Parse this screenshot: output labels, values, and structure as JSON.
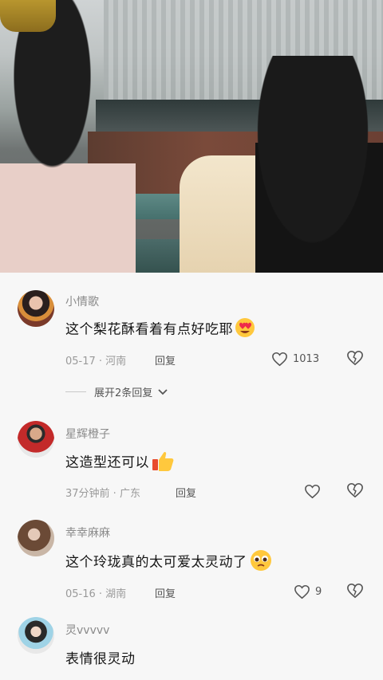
{
  "video": {},
  "comments": [
    {
      "username": "小情歌",
      "text": "这个梨花酥看着有点好吃耶",
      "emoji": "heart-eyes-emoji",
      "date_location": "05-17 · 河南",
      "reply_label": "回复",
      "like_count": "1013",
      "expand_label": "展开2条回复"
    },
    {
      "username": "星辉橙子",
      "text": "这造型还可以",
      "emoji": "thumbs-up-emoji",
      "date_location": "37分钟前 · 广东",
      "reply_label": "回复",
      "like_count": ""
    },
    {
      "username": "幸幸麻麻",
      "text": "这个玲珑真的太可爱太灵动了",
      "emoji": "pleading-face-emoji",
      "date_location": "05-16 · 湖南",
      "reply_label": "回复",
      "like_count": "9"
    },
    {
      "username": "灵vvvvv",
      "text": "表情很灵动",
      "emoji": "",
      "date_location": "",
      "reply_label": "",
      "like_count": ""
    }
  ],
  "colors": {
    "background": "#f7f7f7",
    "username": "#8a8a8a",
    "text": "#161616",
    "meta": "#9a9a9a"
  }
}
